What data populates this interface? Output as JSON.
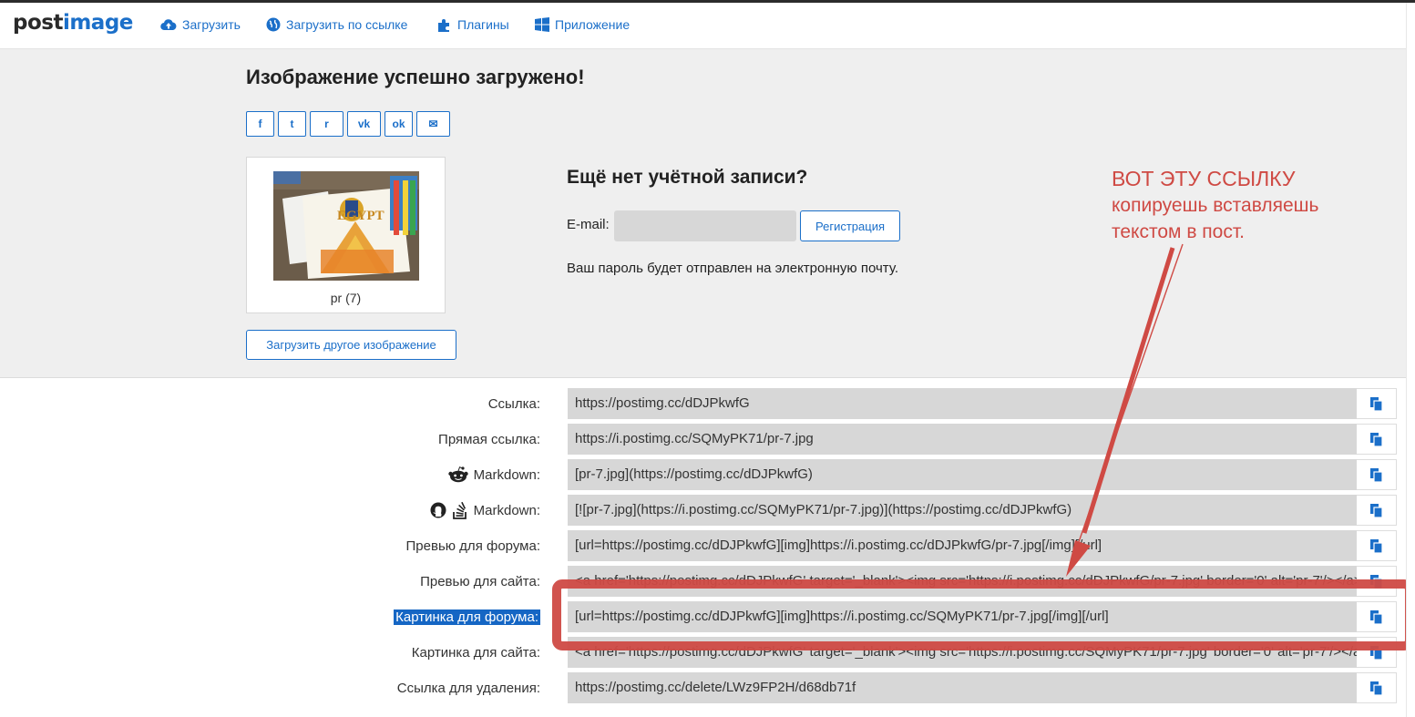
{
  "nav": {
    "logo_a": "post",
    "logo_b": "image",
    "items": [
      {
        "label": "Загрузить",
        "icon": "cloud-upload-icon"
      },
      {
        "label": "Загрузить по ссылке",
        "icon": "globe-icon"
      },
      {
        "label": "Плагины",
        "icon": "puzzle-icon"
      },
      {
        "label": "Приложение",
        "icon": "windows-icon"
      }
    ]
  },
  "hero": {
    "title": "Изображение успешно загружено!",
    "share": [
      {
        "glyph": "f",
        "icon": "facebook-icon"
      },
      {
        "glyph": "t",
        "icon": "twitter-icon"
      },
      {
        "glyph": "r",
        "icon": "reddit-icon"
      },
      {
        "glyph": "vk",
        "icon": "vk-icon"
      },
      {
        "glyph": "ok",
        "icon": "odnoklassniki-icon"
      },
      {
        "glyph": "✉",
        "icon": "email-icon"
      }
    ],
    "thumb_caption": "pr (7)",
    "thumb_text": "EGYPT",
    "upload_other": "Загрузить другое изображение"
  },
  "account": {
    "title": "Ещё нет учётной записи?",
    "email_label": "E-mail:",
    "email_value": "",
    "register": "Регистрация",
    "note": "Ваш пароль будет отправлен на электронную почту."
  },
  "annotation": {
    "line1": "ВОТ ЭТУ ССЫЛКУ",
    "line2": "копируешь вставляешь",
    "line3": "текстом в пост."
  },
  "links": [
    {
      "label": "Ссылка:",
      "value": "https://postimg.cc/dDJPkwfG"
    },
    {
      "label": "Прямая ссылка:",
      "value": "https://i.postimg.cc/SQMyPK71/pr-7.jpg"
    },
    {
      "label": "Markdown:",
      "value": "[pr-7.jpg](https://postimg.cc/dDJPkwfG)"
    },
    {
      "label": "Markdown:",
      "value": "[![pr-7.jpg](https://i.postimg.cc/SQMyPK71/pr-7.jpg)](https://postimg.cc/dDJPkwfG)"
    },
    {
      "label": "Превью для форума:",
      "value": "[url=https://postimg.cc/dDJPkwfG][img]https://i.postimg.cc/dDJPkwfG/pr-7.jpg[/img][/url]"
    },
    {
      "label": "Превью для сайта:",
      "value": "<a href='https://postimg.cc/dDJPkwfG' target='_blank'><img src='https://i.postimg.cc/dDJPkwfG/pr-7.jpg' border='0' alt='pr-7'/></a>"
    },
    {
      "label": "Картинка для форума:",
      "value": "[url=https://postimg.cc/dDJPkwfG][img]https://i.postimg.cc/SQMyPK71/pr-7.jpg[/img][/url]"
    },
    {
      "label": "Картинка для сайта:",
      "value": "<a href='https://postimg.cc/dDJPkwfG' target='_blank'><img src='https://i.postimg.cc/SQMyPK71/pr-7.jpg' border='0' alt='pr-7'/></a>"
    },
    {
      "label": "Ссылка для удаления:",
      "value": "https://postimg.cc/delete/LWz9FP2H/d68db71f"
    }
  ],
  "colors": {
    "accent": "#1b6fc9",
    "annotation": "#cf4a44",
    "selection": "#1566c4"
  }
}
